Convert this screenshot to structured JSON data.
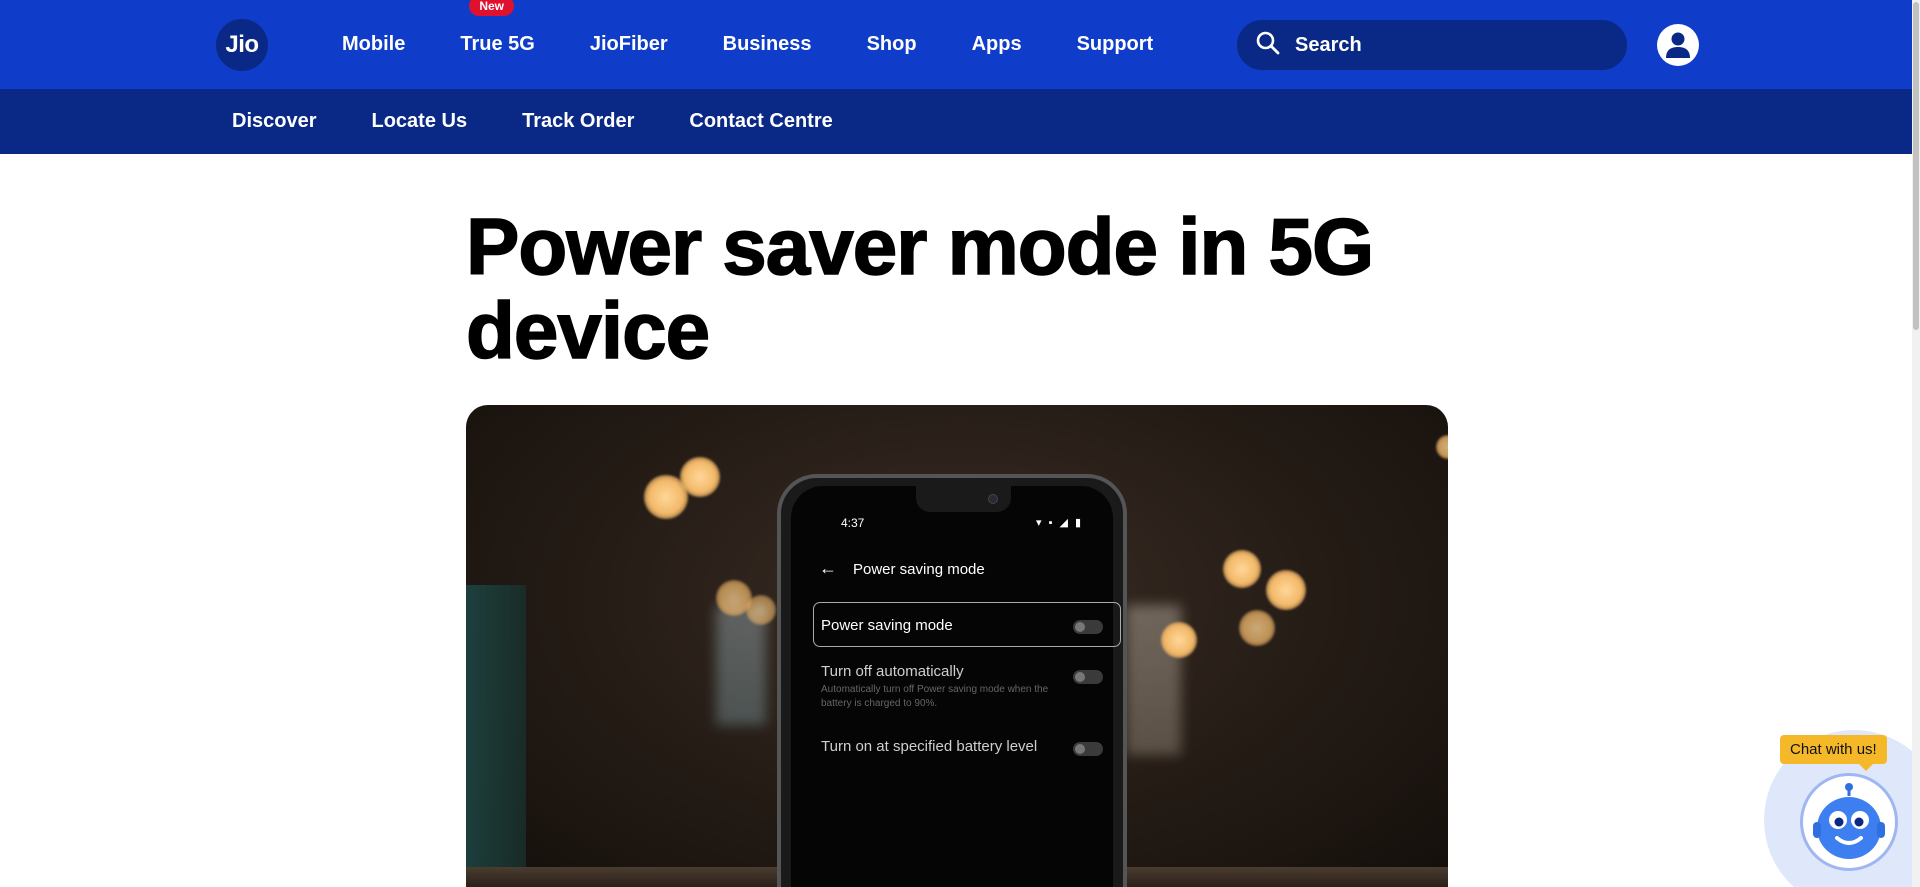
{
  "header": {
    "logo_text": "Jio",
    "nav": [
      {
        "label": "Mobile"
      },
      {
        "label": "True 5G",
        "badge": "New"
      },
      {
        "label": "JioFiber"
      },
      {
        "label": "Business"
      },
      {
        "label": "Shop"
      },
      {
        "label": "Apps"
      },
      {
        "label": "Support"
      }
    ],
    "search_placeholder": "Search",
    "colors": {
      "primary": "#0f3cc9",
      "secondary": "#0a2885",
      "badge": "#e0102f"
    }
  },
  "subnav": [
    "Discover",
    "Locate Us",
    "Track Order",
    "Contact Centre"
  ],
  "article": {
    "title": "Power saver mode in 5G device"
  },
  "hero_phone": {
    "time": "4:37",
    "screen_title": "Power saving mode",
    "rows": [
      {
        "label": "Power saving mode"
      },
      {
        "label": "Turn off automatically",
        "sub": "Automatically turn off Power saving mode when the battery is charged to 90%."
      },
      {
        "label": "Turn on at specified battery level"
      }
    ]
  },
  "chat": {
    "tooltip": "Chat with us!",
    "color": "#f5b829"
  },
  "icons": [
    "search-icon",
    "user-icon",
    "back-arrow-icon",
    "chatbot-icon"
  ]
}
